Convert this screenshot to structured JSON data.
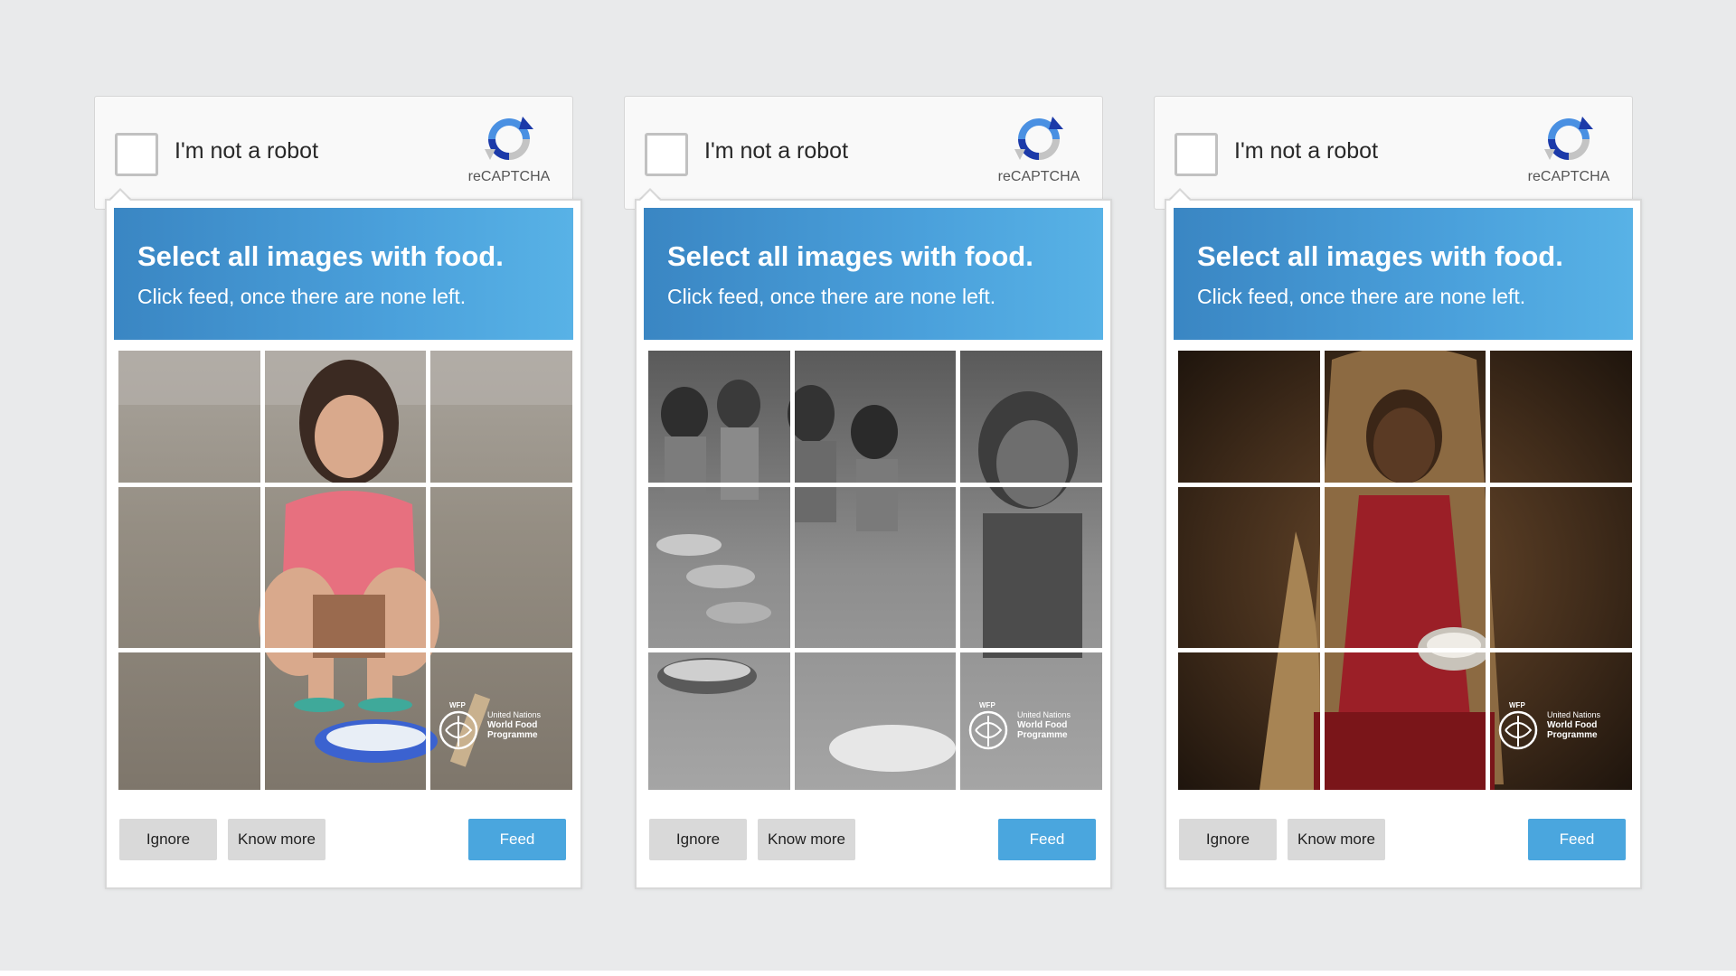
{
  "colors": {
    "background": "#e9eaeb",
    "header_gradient_start": "#3a86c3",
    "header_gradient_end": "#58b2e6",
    "feed_button": "#4aa6de",
    "secondary_button": "#d9d9d9"
  },
  "captchas": [
    {
      "checkbox_label": "I'm not a robot",
      "logo_text": "reCAPTCHA",
      "logo_icon": "recaptcha-logo-icon",
      "title": "Select all images with food.",
      "subtitle": "Click feed, once there are none left.",
      "image_theme": "color",
      "watermark": {
        "tag": "WFP",
        "line1": "United Nations",
        "line2": "World Food",
        "line3": "Programme"
      },
      "buttons": {
        "ignore": "Ignore",
        "know_more": "Know more",
        "feed": "Feed"
      }
    },
    {
      "checkbox_label": "I'm not a robot",
      "logo_text": "reCAPTCHA",
      "logo_icon": "recaptcha-logo-icon",
      "title": "Select all images with food.",
      "subtitle": "Click feed, once there are none left.",
      "image_theme": "grayscale",
      "watermark": {
        "tag": "WFP",
        "line1": "United Nations",
        "line2": "World Food",
        "line3": "Programme"
      },
      "buttons": {
        "ignore": "Ignore",
        "know_more": "Know more",
        "feed": "Feed"
      }
    },
    {
      "checkbox_label": "I'm not a robot",
      "logo_text": "reCAPTCHA",
      "logo_icon": "recaptcha-logo-icon",
      "title": "Select all images with food.",
      "subtitle": "Click feed, once there are none left.",
      "image_theme": "warm",
      "watermark": {
        "tag": "WFP",
        "line1": "United Nations",
        "line2": "World Food",
        "line3": "Programme"
      },
      "buttons": {
        "ignore": "Ignore",
        "know_more": "Know more",
        "feed": "Feed"
      }
    }
  ]
}
